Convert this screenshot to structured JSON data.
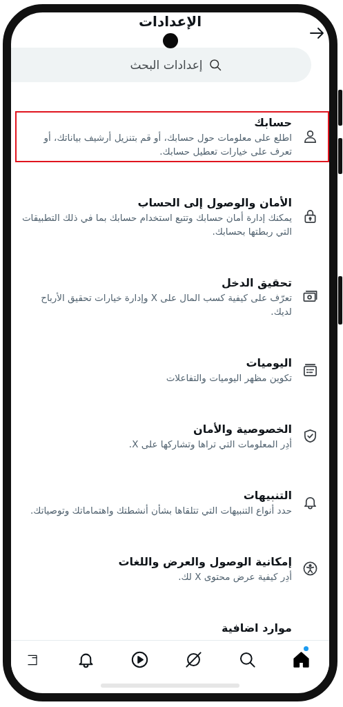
{
  "header": {
    "title": "الإعدادات"
  },
  "search": {
    "placeholder": "إعدادات البحث"
  },
  "items": [
    {
      "kind": "person",
      "title": "حسابك",
      "description": "اطلع على معلومات حول حسابك، أو قم بتنزيل أرشيف بياناتك، أو تعرف على خيارات تعطيل حسابك.",
      "highlighted": true
    },
    {
      "kind": "lock",
      "title": "الأمان والوصول إلى الحساب",
      "description": "يمكنك إدارة أمان حسابك وتتبع استخدام حسابك بما في ذلك التطبيقات التي ربطتها بحسابك.",
      "highlighted": false
    },
    {
      "kind": "money",
      "title": "تحقيق الدخل",
      "description": "تعرّف على كيفية كسب المال على X وإدارة خيارات تحقيق الأرباح لديك.",
      "highlighted": false
    },
    {
      "kind": "feed",
      "title": "اليوميات",
      "description": "تكوين مظهر اليوميات والتفاعلات",
      "highlighted": false
    },
    {
      "kind": "shield",
      "title": "الخصوصية والأمان",
      "description": "أدِر المعلومات التي تراها وتشاركها على X.",
      "highlighted": false
    },
    {
      "kind": "bell",
      "title": "التنبيهات",
      "description": "حدد أنواع التنبيهات التي تتلقاها بشأن أنشطتك واهتماماتك وتوصياتك.",
      "highlighted": false
    },
    {
      "kind": "access",
      "title": "إمكانية الوصول والعرض واللغات",
      "description": "أدِر كيفية عرض محتوى X لك.",
      "highlighted": false
    },
    {
      "kind": "none",
      "title": "موارد اضافية",
      "highlighted": false
    }
  ],
  "nav": [
    {
      "kind": "home",
      "selected": true,
      "dot": true
    },
    {
      "kind": "search",
      "selected": false,
      "dot": false
    },
    {
      "kind": "slash",
      "selected": false,
      "dot": false
    },
    {
      "kind": "play",
      "selected": false,
      "dot": false
    },
    {
      "kind": "bell",
      "selected": false,
      "dot": false
    },
    {
      "kind": "partial",
      "selected": false,
      "dot": false
    }
  ]
}
